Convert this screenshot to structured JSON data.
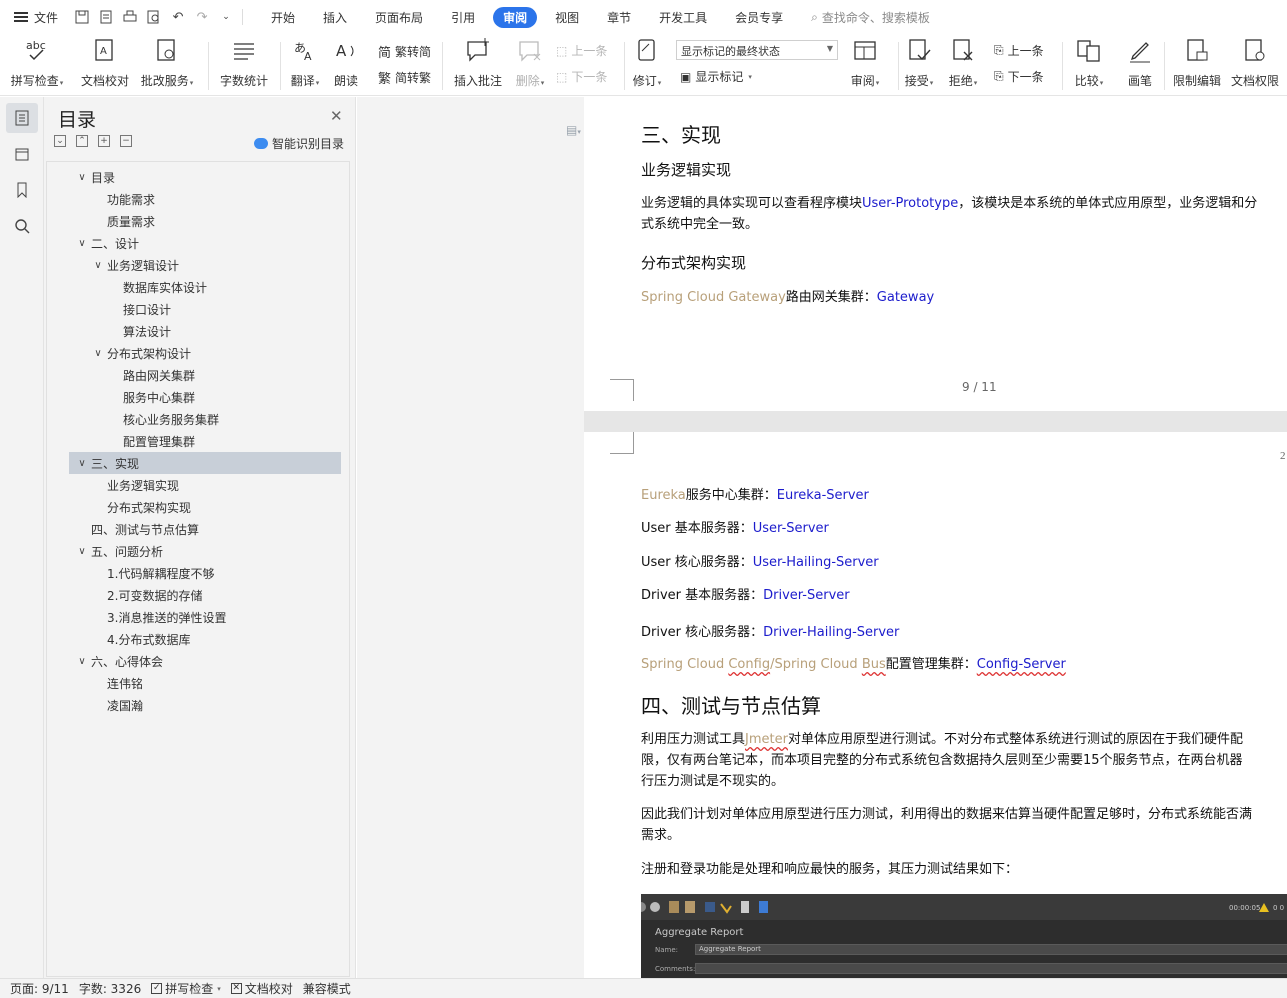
{
  "menubar": {
    "file_label": "文件",
    "tabs": [
      "开始",
      "插入",
      "页面布局",
      "引用",
      "审阅",
      "视图",
      "章节",
      "开发工具",
      "会员专享"
    ],
    "active_tab": "审阅",
    "search_placeholder": "查找命令、搜索模板"
  },
  "ribbon": {
    "spell_check": "拼写检查",
    "doc_proofread": "文档校对",
    "batch_service": "批改服务",
    "word_count": "字数统计",
    "translate": "翻译",
    "read_aloud": "朗读",
    "to_traditional": "繁转简",
    "to_simplified": "简转繁",
    "insert_comment": "插入批注",
    "delete": "删除",
    "prev_comment": "上一条",
    "next_comment": "下一条",
    "track_changes": "修订",
    "markup_select": "显示标记的最终状态",
    "show_markup": "显示标记",
    "review": "审阅",
    "accept": "接受",
    "reject": "拒绝",
    "prev_change": "上一条",
    "next_change": "下一条",
    "compare": "比较",
    "pen": "画笔",
    "restrict_edit": "限制编辑",
    "doc_permission": "文档权限"
  },
  "toc": {
    "title": "目录",
    "smart_label": "智能识别目录",
    "items": [
      {
        "label": "目录",
        "level": 1,
        "expanded": true
      },
      {
        "label": "功能需求",
        "level": 2
      },
      {
        "label": "质量需求",
        "level": 2
      },
      {
        "label": "二、设计",
        "level": 1,
        "expanded": true
      },
      {
        "label": "业务逻辑设计",
        "level": 2,
        "expanded": true
      },
      {
        "label": "数据库实体设计",
        "level": 3
      },
      {
        "label": "接口设计",
        "level": 3
      },
      {
        "label": "算法设计",
        "level": 3
      },
      {
        "label": "分布式架构设计",
        "level": 2,
        "expanded": true
      },
      {
        "label": "路由网关集群",
        "level": 3
      },
      {
        "label": "服务中心集群",
        "level": 3
      },
      {
        "label": "核心业务服务集群",
        "level": 3
      },
      {
        "label": "配置管理集群",
        "level": 3
      },
      {
        "label": "三、实现",
        "level": 1,
        "expanded": true,
        "selected": true
      },
      {
        "label": "业务逻辑实现",
        "level": 2
      },
      {
        "label": "分布式架构实现",
        "level": 2
      },
      {
        "label": "四、测试与节点估算",
        "level": 1
      },
      {
        "label": "五、问题分析",
        "level": 1,
        "expanded": true
      },
      {
        "label": "1.代码解耦程度不够",
        "level": 2
      },
      {
        "label": "2.可变数据的存储",
        "level": 2
      },
      {
        "label": "3.消息推送的弹性设置",
        "level": 2
      },
      {
        "label": "4.分布式数据库",
        "level": 2
      },
      {
        "label": "六、心得体会",
        "level": 1,
        "expanded": true
      },
      {
        "label": "连伟铭",
        "level": 2
      },
      {
        "label": "凌国瀚",
        "level": 2
      }
    ]
  },
  "doc": {
    "page1": {
      "h_impl": "三、实现",
      "h_biz": "业务逻辑实现",
      "para1_a": "业务逻辑的具体实现可以查看程序模块",
      "para1_link": "User-Prototype",
      "para1_b": "，该模块是本系统的单体式应用原型，业务逻辑和分",
      "para1_c": "式系统中完全一致。",
      "h_dist": "分布式架构实现",
      "gw_tan": "Spring Cloud Gateway",
      "gw_label": "路由网关集群：",
      "gw_link": "Gateway",
      "page_num": "9 / 11"
    },
    "page2": {
      "corner_mark": "2",
      "eureka_tan": "Eureka",
      "eureka_label": "服务中心集群：",
      "eureka_link": "Eureka-Server",
      "user_basic_label": "User 基本服务器：",
      "user_basic_link": "User-Server",
      "user_core_label": "User 核心服务器：",
      "user_core_link": "User-Hailing-Server",
      "driver_basic_label": "Driver 基本服务器：",
      "driver_basic_link": "Driver-Server",
      "driver_core_label": "Driver 核心服务器：",
      "driver_core_link": "Driver-Hailing-Server",
      "config_tan_a": "Spring Cloud ",
      "config_tan_b": "Config",
      "config_tan_c": "/Spring Cloud ",
      "config_tan_d": "Bus",
      "config_label": "配置管理集群：",
      "config_link": "Config-Server",
      "h_test": "四、测试与节点估算",
      "t1_a": "利用压力测试工具",
      "t1_tool": "Jmeter",
      "t1_b": "对单体应用原型进行测试。不对分布式整体系统进行测试的原因在于我们硬件配",
      "t1_c": "限，仅有两台笔记本，而本项目完整的分布式系统包含数据持久层则至少需要15个服务节点，在两台机器",
      "t1_d": "行压力测试是不现实的。",
      "t2_a": "因此我们计划对单体应用原型进行压力测试，利用得出的数据来估算当硬件配置足够时，分布式系统能否满",
      "t2_b": "需求。",
      "t3": "注册和登录功能是处理和响应最快的服务，其压力测试结果如下：",
      "jm_title": "Aggregate Report",
      "jm_name_label": "Name:",
      "jm_name_value": "Aggregate Report",
      "jm_comments_label": "Comments:",
      "jm_time": "00:00:05"
    }
  },
  "status": {
    "page": "页面: 9/11",
    "words": "字数: 3326",
    "spell": "拼写检查",
    "proof": "文档校对",
    "compat": "兼容模式"
  }
}
